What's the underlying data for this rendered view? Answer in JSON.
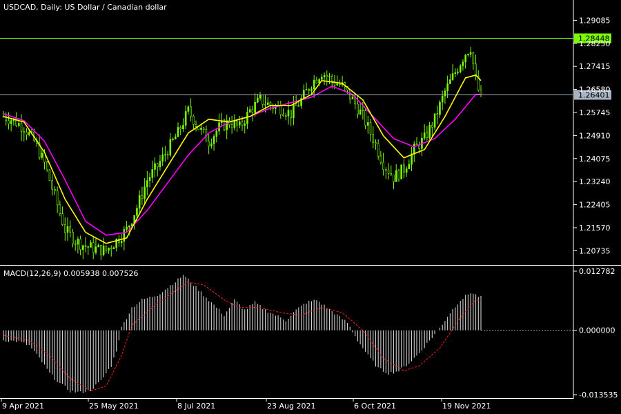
{
  "chart_data": [
    {
      "type": "candlestick",
      "title": "USDCAD, Daily:  US Dollar / Canadian dollar",
      "ylim": [
        1.2022,
        1.2982
      ],
      "yticks": [
        "1.29085",
        "1.28250",
        "1.27415",
        "1.26580",
        "1.25745",
        "1.24910",
        "1.24075",
        "1.23240",
        "1.22405",
        "1.21570",
        "1.20735"
      ],
      "colors": {
        "bull": "#7CFC00",
        "bear": "#7CFC00",
        "ma_fast": "#FFFF00",
        "ma_slow": "#FF00FF",
        "hline_top": "#7CFC00",
        "hline_price": "#A9B4C2",
        "grid": "off"
      },
      "hlines": [
        {
          "value": 1.28448,
          "label": "1.28448",
          "color": "#7CFC00"
        },
        {
          "value": 1.26401,
          "label": "1.26401",
          "color": "#A9B4C2"
        }
      ],
      "price_path": [
        [
          0,
          1.256
        ],
        [
          4,
          1.2545
        ],
        [
          8,
          1.252
        ],
        [
          12,
          1.247
        ],
        [
          16,
          1.239
        ],
        [
          20,
          1.227
        ],
        [
          24,
          1.215
        ],
        [
          28,
          1.211
        ],
        [
          32,
          1.209
        ],
        [
          36,
          1.208
        ],
        [
          40,
          1.2075
        ],
        [
          44,
          1.211
        ],
        [
          48,
          1.215
        ],
        [
          52,
          1.223
        ],
        [
          56,
          1.233
        ],
        [
          60,
          1.238
        ],
        [
          64,
          1.244
        ],
        [
          68,
          1.25
        ],
        [
          72,
          1.258
        ],
        [
          76,
          1.252
        ],
        [
          80,
          1.247
        ],
        [
          84,
          1.252
        ],
        [
          88,
          1.254
        ],
        [
          92,
          1.252
        ],
        [
          96,
          1.258
        ],
        [
          100,
          1.262
        ],
        [
          104,
          1.26
        ],
        [
          108,
          1.259
        ],
        [
          112,
          1.257
        ],
        [
          116,
          1.262
        ],
        [
          120,
          1.268
        ],
        [
          124,
          1.272
        ],
        [
          128,
          1.269
        ],
        [
          132,
          1.267
        ],
        [
          136,
          1.262
        ],
        [
          140,
          1.256
        ],
        [
          144,
          1.248
        ],
        [
          148,
          1.239
        ],
        [
          152,
          1.234
        ],
        [
          156,
          1.237
        ],
        [
          160,
          1.244
        ],
        [
          164,
          1.248
        ],
        [
          168,
          1.255
        ],
        [
          172,
          1.265
        ],
        [
          176,
          1.272
        ],
        [
          180,
          1.279
        ],
        [
          182,
          1.281
        ],
        [
          184,
          1.269
        ],
        [
          186,
          1.262
        ]
      ],
      "ma_fast": [
        [
          0,
          1.256
        ],
        [
          8,
          1.254
        ],
        [
          16,
          1.243
        ],
        [
          24,
          1.226
        ],
        [
          32,
          1.214
        ],
        [
          40,
          1.21
        ],
        [
          48,
          1.212
        ],
        [
          56,
          1.226
        ],
        [
          64,
          1.238
        ],
        [
          72,
          1.25
        ],
        [
          80,
          1.255
        ],
        [
          88,
          1.254
        ],
        [
          96,
          1.256
        ],
        [
          104,
          1.26
        ],
        [
          112,
          1.26
        ],
        [
          120,
          1.264
        ],
        [
          124,
          1.269
        ],
        [
          132,
          1.268
        ],
        [
          140,
          1.262
        ],
        [
          148,
          1.249
        ],
        [
          156,
          1.241
        ],
        [
          164,
          1.244
        ],
        [
          172,
          1.256
        ],
        [
          180,
          1.27
        ],
        [
          184,
          1.271
        ],
        [
          186,
          1.269
        ]
      ],
      "ma_slow": [
        [
          0,
          1.257
        ],
        [
          8,
          1.2545
        ],
        [
          16,
          1.247
        ],
        [
          24,
          1.233
        ],
        [
          32,
          1.218
        ],
        [
          40,
          1.213
        ],
        [
          48,
          1.214
        ],
        [
          56,
          1.222
        ],
        [
          64,
          1.232
        ],
        [
          72,
          1.242
        ],
        [
          80,
          1.25
        ],
        [
          88,
          1.254
        ],
        [
          96,
          1.256
        ],
        [
          104,
          1.259
        ],
        [
          112,
          1.261
        ],
        [
          120,
          1.263
        ],
        [
          128,
          1.267
        ],
        [
          136,
          1.264
        ],
        [
          144,
          1.256
        ],
        [
          152,
          1.248
        ],
        [
          160,
          1.245
        ],
        [
          168,
          1.248
        ],
        [
          176,
          1.255
        ],
        [
          184,
          1.264
        ],
        [
          186,
          1.264
        ]
      ]
    },
    {
      "type": "bar",
      "title": "MACD(12,26,9) 0.005938 0.007526",
      "ylim": [
        -0.013535,
        0.012782
      ],
      "yticks": [
        "0.012782",
        "0.000000",
        "-0.013535"
      ],
      "colors": {
        "histogram": "#D3D3D3",
        "signal": "#FF2020",
        "zero_line": "#A0A0A0"
      },
      "macd_path": [
        [
          0,
          -0.002
        ],
        [
          6,
          -0.0022
        ],
        [
          10,
          -0.003
        ],
        [
          14,
          -0.0055
        ],
        [
          18,
          -0.0085
        ],
        [
          22,
          -0.0105
        ],
        [
          26,
          -0.012
        ],
        [
          30,
          -0.0123
        ],
        [
          34,
          -0.0118
        ],
        [
          38,
          -0.01
        ],
        [
          42,
          -0.007
        ],
        [
          44,
          -0.004
        ],
        [
          46,
          0.0005
        ],
        [
          50,
          0.0045
        ],
        [
          54,
          0.006
        ],
        [
          60,
          0.007
        ],
        [
          64,
          0.0085
        ],
        [
          68,
          0.01
        ],
        [
          70,
          0.011
        ],
        [
          74,
          0.009
        ],
        [
          78,
          0.007
        ],
        [
          82,
          0.005
        ],
        [
          86,
          0.003
        ],
        [
          90,
          0.006
        ],
        [
          94,
          0.004
        ],
        [
          98,
          0.0055
        ],
        [
          102,
          0.004
        ],
        [
          106,
          0.003
        ],
        [
          110,
          0.002
        ],
        [
          114,
          0.004
        ],
        [
          118,
          0.0055
        ],
        [
          122,
          0.006
        ],
        [
          126,
          0.0045
        ],
        [
          130,
          0.003
        ],
        [
          134,
          0.0015
        ],
        [
          138,
          -0.002
        ],
        [
          142,
          -0.005
        ],
        [
          146,
          -0.0075
        ],
        [
          150,
          -0.0085
        ],
        [
          154,
          -0.008
        ],
        [
          158,
          -0.0065
        ],
        [
          162,
          -0.0045
        ],
        [
          166,
          -0.002
        ],
        [
          170,
          0.0005
        ],
        [
          174,
          0.0035
        ],
        [
          178,
          0.006
        ],
        [
          182,
          0.0075
        ],
        [
          184,
          0.007
        ],
        [
          186,
          0.0065
        ]
      ],
      "signal_path": [
        [
          0,
          -0.001
        ],
        [
          10,
          -0.002
        ],
        [
          18,
          -0.005
        ],
        [
          26,
          -0.0095
        ],
        [
          34,
          -0.012
        ],
        [
          40,
          -0.011
        ],
        [
          46,
          -0.005
        ],
        [
          50,
          0.001
        ],
        [
          58,
          0.0045
        ],
        [
          66,
          0.0075
        ],
        [
          72,
          0.0095
        ],
        [
          78,
          0.009
        ],
        [
          86,
          0.006
        ],
        [
          92,
          0.0045
        ],
        [
          100,
          0.0045
        ],
        [
          108,
          0.0035
        ],
        [
          116,
          0.003
        ],
        [
          124,
          0.0045
        ],
        [
          132,
          0.0035
        ],
        [
          140,
          0.0
        ],
        [
          148,
          -0.0055
        ],
        [
          156,
          -0.008
        ],
        [
          162,
          -0.007
        ],
        [
          170,
          -0.0035
        ],
        [
          178,
          0.0025
        ],
        [
          184,
          0.006
        ],
        [
          186,
          0.006
        ]
      ]
    }
  ],
  "x_axis": {
    "labels": [
      "9 Apr 2021",
      "25 May 2021",
      "8 Jul 2021",
      "23 Aug 2021",
      "6 Oct 2021",
      "19 Nov 2021"
    ],
    "bar_count": 187
  }
}
